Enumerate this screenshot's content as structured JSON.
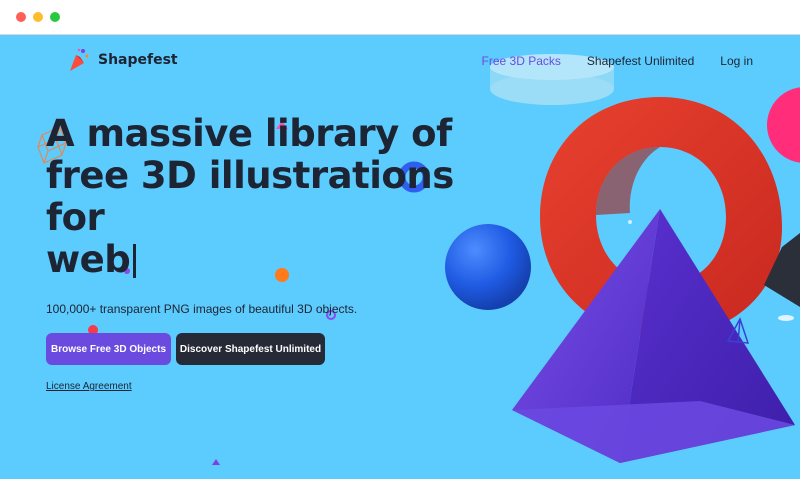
{
  "brand": {
    "name": "Shapefest"
  },
  "nav": {
    "items": [
      {
        "label": "Free 3D Packs",
        "active": true
      },
      {
        "label": "Shapefest Unlimited",
        "active": false
      },
      {
        "label": "Log in",
        "active": false
      }
    ]
  },
  "hero": {
    "headline_lines": [
      "A massive library of",
      "free 3D illustrations",
      "for",
      "web"
    ],
    "subtitle": "100,000+ transparent PNG images of beautiful 3D objects.",
    "primary_button": "Browse Free 3D Objects",
    "secondary_button": "Discover Shapefest Unlimited",
    "license_link": "License Agreement"
  },
  "colors": {
    "background": "#5ccbfd",
    "accent": "#6b4ae0",
    "dark": "#262a37",
    "text": "#1d2433"
  },
  "icons": [
    "logo-icon",
    "cube-wireframe-icon",
    "torus-icon",
    "sphere-icon",
    "ring-icon",
    "pyramid-icon",
    "cylinder-icon"
  ]
}
